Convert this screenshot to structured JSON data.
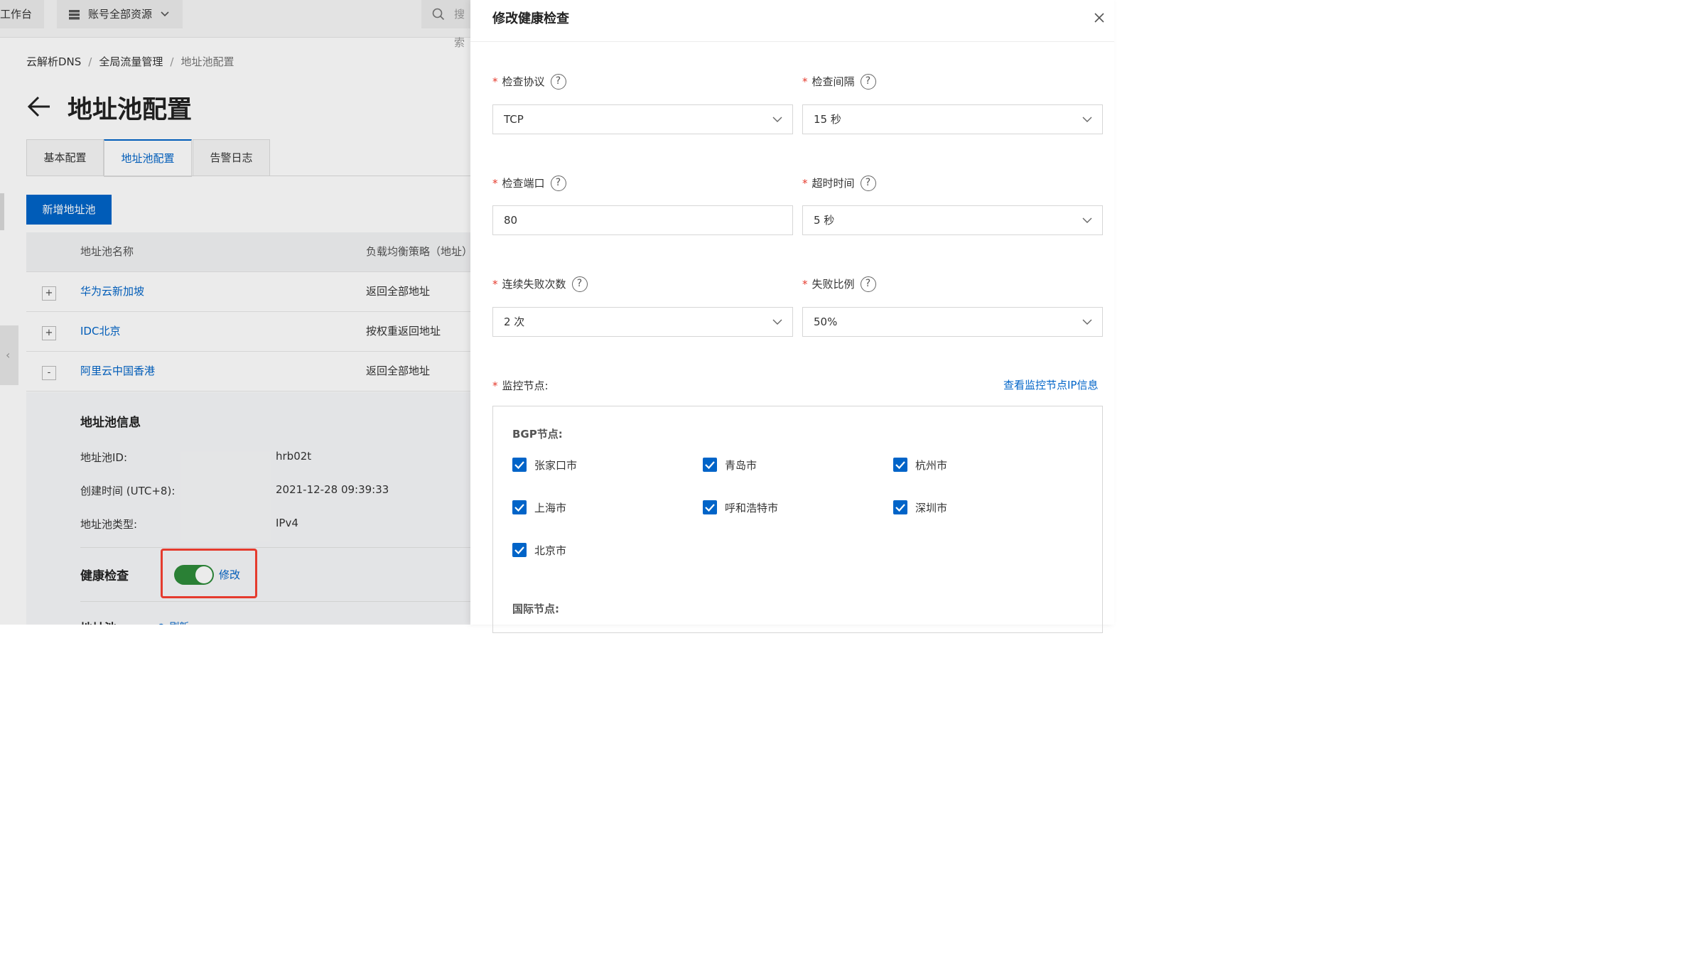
{
  "topbar": {
    "workbench": "工作台",
    "resources": "账号全部资源",
    "search_placeholder": "搜索"
  },
  "breadcrumb": [
    "云解析DNS",
    "全局流量管理",
    "地址池配置"
  ],
  "page_title": "地址池配置",
  "tabs": [
    {
      "label": "基本配置",
      "active": false
    },
    {
      "label": "地址池配置",
      "active": true
    },
    {
      "label": "告警日志",
      "active": false
    }
  ],
  "add_button": "新增地址池",
  "table": {
    "columns": [
      "地址池名称",
      "负载均衡策略（地址）"
    ],
    "rows": [
      {
        "expand": "+",
        "name": "华为云新加坡",
        "policy": "返回全部地址"
      },
      {
        "expand": "+",
        "name": "IDC北京",
        "policy": "按权重返回地址"
      },
      {
        "expand": "-",
        "name": "阿里云中国香港",
        "policy": "返回全部地址"
      }
    ]
  },
  "detail": {
    "title": "地址池信息",
    "fields": [
      {
        "label": "地址池ID:",
        "value": "hrb02t"
      },
      {
        "label": "创建时间 (UTC+8):",
        "value": "2021-12-28 09:39:33"
      },
      {
        "label": "地址池类型:",
        "value": "IPv4"
      }
    ],
    "health_check_title": "健康检查",
    "health_check_enabled": true,
    "health_check_edit": "修改",
    "address_title": "地址池",
    "refresh_label": "刷新"
  },
  "drawer": {
    "title": "修改健康检查",
    "fields": {
      "protocol": {
        "label": "检查协议",
        "value": "TCP"
      },
      "interval": {
        "label": "检查间隔",
        "value": "15 秒"
      },
      "port": {
        "label": "检查端口",
        "value": "80"
      },
      "timeout": {
        "label": "超时时间",
        "value": "5 秒"
      },
      "fail_count": {
        "label": "连续失败次数",
        "value": "2 次"
      },
      "fail_ratio": {
        "label": "失败比例",
        "value": "50%"
      }
    },
    "monitor_label": "监控节点:",
    "monitor_ip_link": "查看监控节点IP信息",
    "bgp_label": "BGP节点:",
    "bgp_nodes": [
      {
        "name": "张家口市",
        "checked": true
      },
      {
        "name": "青岛市",
        "checked": true
      },
      {
        "name": "杭州市",
        "checked": true
      },
      {
        "name": "上海市",
        "checked": true
      },
      {
        "name": "呼和浩特市",
        "checked": true
      },
      {
        "name": "深圳市",
        "checked": true
      },
      {
        "name": "北京市",
        "checked": true
      }
    ],
    "intl_label": "国际节点:"
  },
  "colors": {
    "primary": "#0064c8",
    "toggle_on": "#2e8b3a",
    "highlight": "#e53b2e",
    "required": "#e53b2e"
  }
}
